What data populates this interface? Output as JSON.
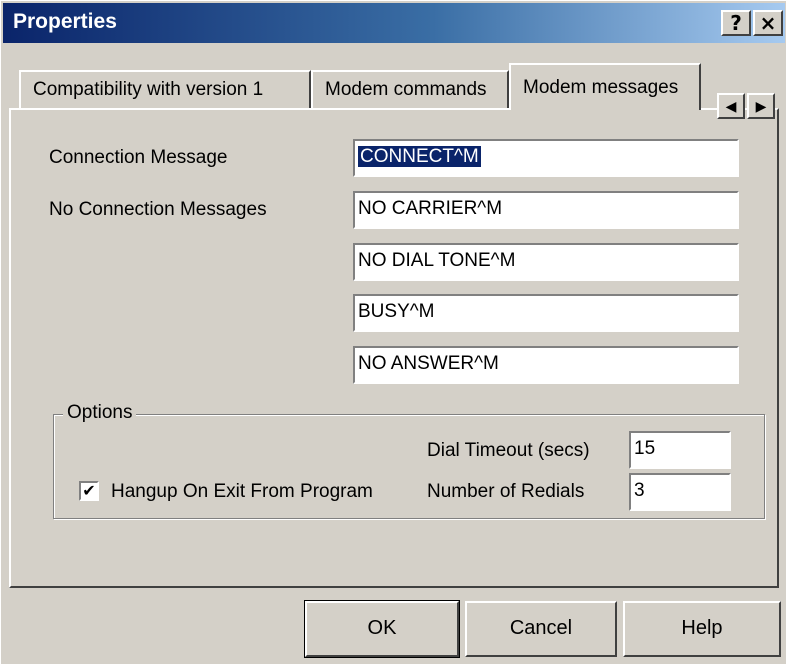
{
  "window": {
    "title": "Properties"
  },
  "titlebar": {
    "help_glyph": "?",
    "close_glyph": "×"
  },
  "tabs": [
    {
      "label": "Compatibility with version 1"
    },
    {
      "label": "Modem commands"
    },
    {
      "label": "Modem messages",
      "selected": true
    }
  ],
  "tab_scroll": {
    "left_glyph": "◀",
    "right_glyph": "▶"
  },
  "connection_message": {
    "label": "Connection Message",
    "value": "CONNECT^M"
  },
  "no_connection_messages": {
    "label": "No Connection Messages",
    "values": [
      "NO CARRIER^M",
      "NO DIAL TONE^M",
      "BUSY^M",
      "NO ANSWER^M"
    ]
  },
  "options": {
    "title": "Options",
    "dial_timeout": {
      "label": "Dial Timeout (secs)",
      "value": "15"
    },
    "redials": {
      "label": "Number of Redials",
      "value": "3"
    },
    "hangup": {
      "label": "Hangup On Exit From Program",
      "checked": true,
      "check_glyph": "✔"
    }
  },
  "buttons": {
    "ok": "OK",
    "cancel": "Cancel",
    "help": "Help"
  },
  "colors": {
    "title_start": "#0a246a",
    "title_end": "#a6caf0",
    "selection": "#0a246a",
    "face": "#d4d0c8"
  }
}
